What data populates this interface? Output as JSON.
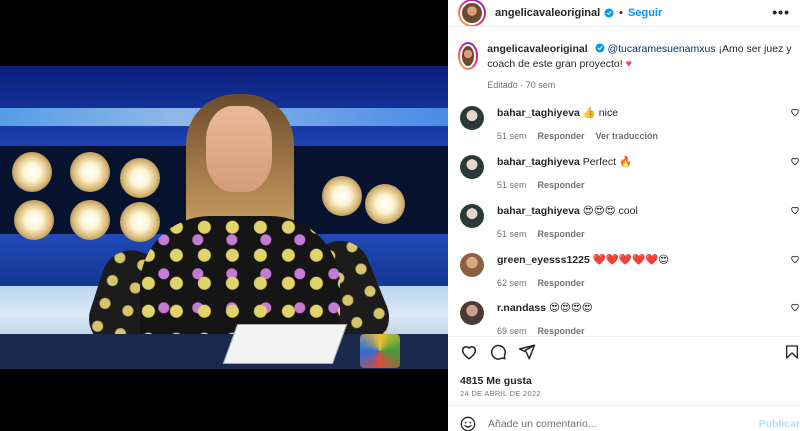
{
  "post": {
    "username": "angelicavaleoriginal",
    "separator": "•",
    "follow_label": "Seguir",
    "more_label": "•••"
  },
  "caption": {
    "username": "angelicavaleoriginal",
    "mention": "@tucaramesuenamxus",
    "text": " ¡Amo ser juez y coach de este gran proyecto! ",
    "heart": "♥",
    "meta": "Editado · 70 sem"
  },
  "comments": [
    {
      "username": "bahar_taghiyeva",
      "text": " 👍 nice",
      "time": "51 sem",
      "reply": "Responder",
      "translate": "Ver traducción"
    },
    {
      "username": "bahar_taghiyeva",
      "text": " Perfect 🔥",
      "time": "51 sem",
      "reply": "Responder"
    },
    {
      "username": "bahar_taghiyeva",
      "text": " 😍😍😍 cool",
      "time": "51 sem",
      "reply": "Responder"
    },
    {
      "username": "green_eyesss1225",
      "text": " ❤️❤️❤️❤️❤️😍",
      "time": "62 sem",
      "reply": "Responder"
    },
    {
      "username": "r.nandass",
      "text": " 😍😍😍😍",
      "time": "69 sem",
      "reply": "Responder"
    }
  ],
  "likes": "4815 Me gusta",
  "date": "24 DE ABRIL DE 2022",
  "add_comment": {
    "placeholder": "Añade un comentario...",
    "publish": "Publicar"
  },
  "icons": [
    "verified-badge-icon",
    "more-options-icon",
    "heart-icon",
    "comment-icon",
    "share-icon",
    "bookmark-icon",
    "emoji-icon"
  ],
  "colors": {
    "accent": "#0095f6",
    "mention": "#00376b",
    "heart": "#ed4956",
    "meta": "#737373"
  }
}
